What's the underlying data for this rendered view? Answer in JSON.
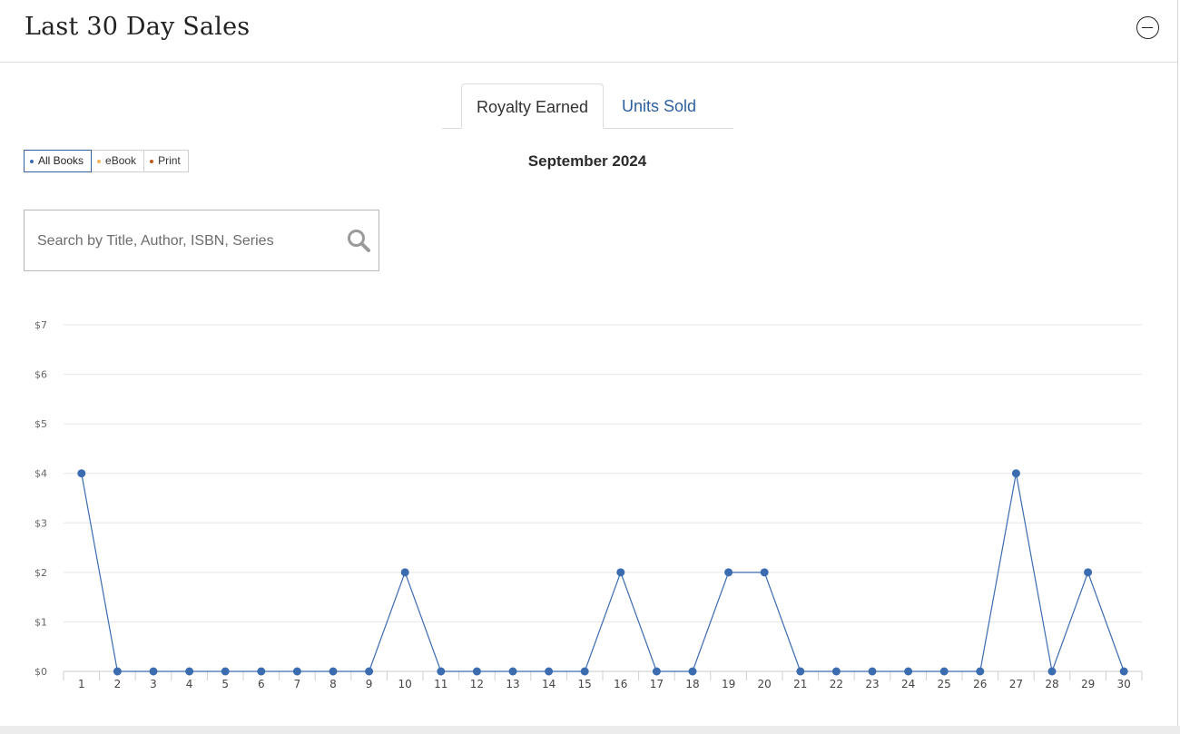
{
  "header": {
    "title": "Last 30 Day Sales"
  },
  "tabs": [
    {
      "label": "Royalty Earned",
      "active": true
    },
    {
      "label": "Units Sold",
      "active": false
    }
  ],
  "filters": [
    {
      "label": "All Books",
      "color": "#3b6cb0",
      "active": true
    },
    {
      "label": "eBook",
      "color": "#f2b45b",
      "active": false
    },
    {
      "label": "Print",
      "color": "#c2561e",
      "active": false
    }
  ],
  "month_label": "September 2024",
  "search": {
    "placeholder": "Search by Title, Author, ISBN, Series",
    "icon": "search-icon"
  },
  "colors": {
    "accent": "#2f5f9e",
    "series": "#3b6cb0"
  },
  "chart_data": {
    "type": "line",
    "title": "",
    "xlabel": "",
    "ylabel": "",
    "x": [
      1,
      2,
      3,
      4,
      5,
      6,
      7,
      8,
      9,
      10,
      11,
      12,
      13,
      14,
      15,
      16,
      17,
      18,
      19,
      20,
      21,
      22,
      23,
      24,
      25,
      26,
      27,
      28,
      29,
      30
    ],
    "series": [
      {
        "values": [
          4,
          0,
          0,
          0,
          0,
          0,
          0,
          0,
          0,
          2,
          0,
          0,
          0,
          0,
          0,
          2,
          0,
          0,
          2,
          2,
          0,
          0,
          0,
          0,
          0,
          0,
          4,
          0,
          2,
          0
        ]
      }
    ],
    "ylim": [
      0,
      7
    ],
    "yticks": [
      "$0",
      "$1",
      "$2",
      "$3",
      "$4",
      "$5",
      "$6",
      "$7"
    ],
    "grid": true
  }
}
